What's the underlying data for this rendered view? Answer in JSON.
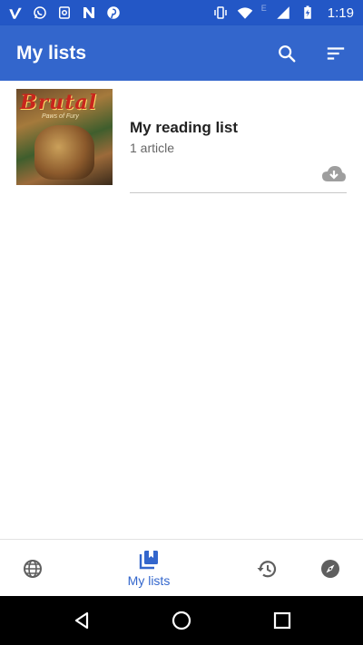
{
  "status_bar": {
    "left_icons": [
      "vimeo-icon",
      "whatsapp-icon",
      "cast-icon",
      "n-icon",
      "pinterest-icon"
    ],
    "right_icons": [
      "vibrate-icon",
      "wifi-icon",
      "signal-icon",
      "battery-charging-icon"
    ],
    "network_label": "E",
    "time": "1:19"
  },
  "app_bar": {
    "title": "My lists",
    "actions": [
      "search-icon",
      "sort-icon"
    ]
  },
  "lists": [
    {
      "title": "My reading list",
      "subtitle": "1 article",
      "thumbnail_text": "Brutal",
      "thumbnail_subtext": "Paws of Fury",
      "action_icon": "cloud-download-icon"
    }
  ],
  "bottom_nav": {
    "items": [
      {
        "icon": "globe-icon",
        "label": ""
      },
      {
        "icon": "bookmarks-icon",
        "label": "My lists",
        "active": true
      },
      {
        "icon": "history-icon",
        "label": ""
      },
      {
        "icon": "compass-icon",
        "label": ""
      }
    ]
  },
  "colors": {
    "status_bar": "#2357c6",
    "app_bar": "#3366cc",
    "accent": "#3366cc",
    "text_primary": "#222222",
    "text_secondary": "#666666",
    "icon_grey": "#5f5f5f"
  }
}
